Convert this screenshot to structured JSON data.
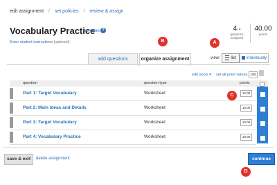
{
  "breadcrumb": {
    "current": "edit assignment",
    "item2": "set policies",
    "item3": "review & assign",
    "sep": "/"
  },
  "title": "Vocabulary Practice",
  "rename": "rename",
  "help_glyph": "?",
  "instructions": {
    "link": "Enter student instructions",
    "optional": "(optional)"
  },
  "stats": {
    "questions": {
      "value": "4",
      "sub": "/ 4",
      "label1": "questions",
      "label2": "assigned"
    },
    "points": {
      "value": "40.00",
      "label": "points"
    }
  },
  "tabs": {
    "add": "add questions",
    "organize": "organize assignment"
  },
  "view": {
    "label": "view:",
    "list": "list",
    "individually": "individually"
  },
  "toolbar": {
    "edit_pools": "edit pools ▾",
    "set_all": "set all point values...",
    "all_value": "100"
  },
  "table": {
    "headers": {
      "question": "question",
      "type": "question type",
      "points": "points"
    },
    "rows": [
      {
        "name": "Part 1: Target Vocabulary",
        "type": "Worksheet",
        "points": "10.00"
      },
      {
        "name": "Part 2: Main Ideas and Details",
        "type": "Worksheet",
        "points": "10.00"
      },
      {
        "name": "Part 3: Target Vocabulary",
        "type": "Worksheet",
        "points": "10.00"
      },
      {
        "name": "Part 4: Vocabulary Practice",
        "type": "Worksheet",
        "points": "10.00"
      }
    ]
  },
  "footer": {
    "save_exit": "save & exit",
    "delete": "delete assignment",
    "continue": "continue"
  },
  "callouts": {
    "a": "A",
    "b": "B",
    "c": "C",
    "d": "D"
  },
  "colors": {
    "accent": "#2e7fd4",
    "link": "#2d6fb7",
    "callout": "#e0322b"
  }
}
